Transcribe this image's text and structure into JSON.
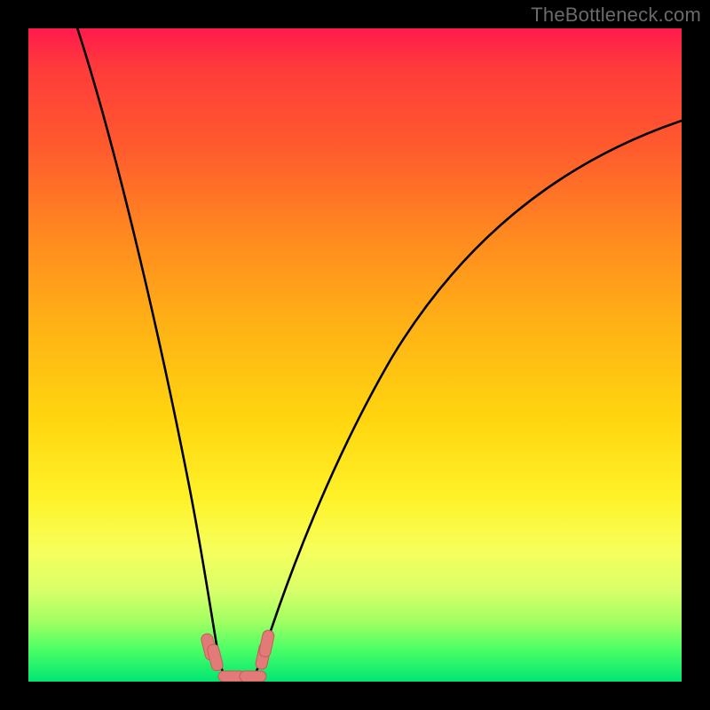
{
  "watermark": "TheBottleneck.com",
  "chart_data": {
    "type": "line",
    "title": "",
    "xlabel": "",
    "ylabel": "",
    "xlim": [
      0,
      100
    ],
    "ylim": [
      0,
      100
    ],
    "grid": false,
    "legend": false,
    "background": "vertical-gradient red→yellow→green",
    "x": [
      0,
      2,
      4,
      6,
      8,
      10,
      12,
      14,
      16,
      18,
      20,
      22,
      24,
      26,
      27,
      28,
      29,
      30,
      31,
      32,
      34,
      36,
      38,
      40,
      44,
      48,
      52,
      56,
      60,
      66,
      72,
      80,
      88,
      96,
      100
    ],
    "series": [
      {
        "name": "curve",
        "values": [
          100,
          91,
          83,
          75,
          67,
          60,
          53,
          46,
          40,
          34,
          28,
          22,
          16,
          10,
          7,
          4,
          1.5,
          0,
          0,
          0,
          1.5,
          4,
          7,
          11,
          19,
          27,
          34,
          41,
          47,
          55,
          62,
          70,
          77,
          83,
          86
        ]
      }
    ],
    "markers": [
      {
        "name": "left-cluster",
        "x": 27.0,
        "y": 5.0
      },
      {
        "name": "left-cluster",
        "x": 27.6,
        "y": 3.0
      },
      {
        "name": "bottom-cluster",
        "x": 29.5,
        "y": 0.0
      },
      {
        "name": "bottom-cluster",
        "x": 31.0,
        "y": 0.0
      },
      {
        "name": "right-cluster",
        "x": 34.5,
        "y": 5.0
      },
      {
        "name": "right-cluster",
        "x": 35.0,
        "y": 7.0
      }
    ],
    "marker_style": {
      "shape": "rounded-rect",
      "color": "#e27a77",
      "stroke": "#c25d5a"
    }
  }
}
